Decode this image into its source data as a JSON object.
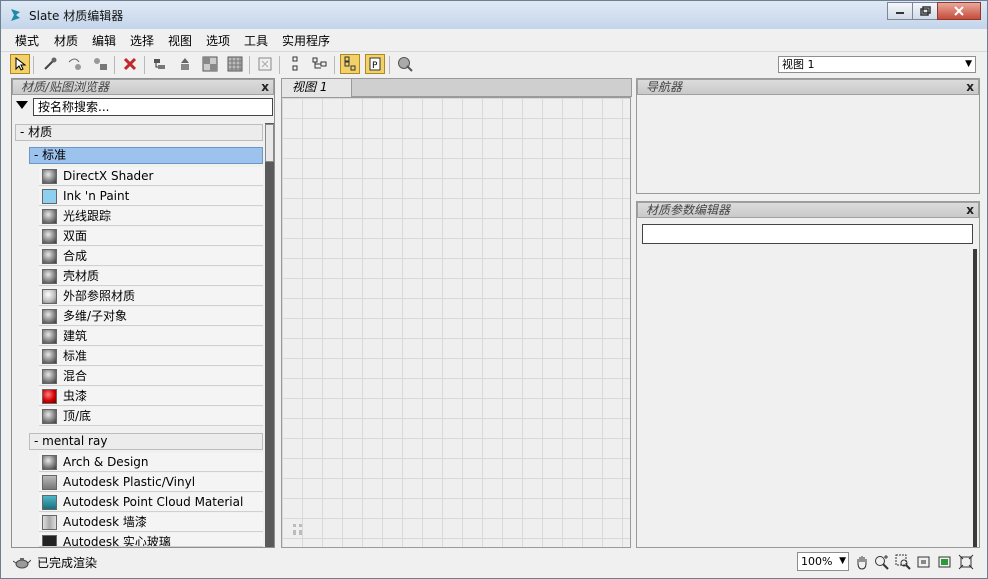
{
  "window": {
    "title": "Slate 材质编辑器"
  },
  "menu": [
    "模式",
    "材质",
    "编辑",
    "选择",
    "视图",
    "选项",
    "工具",
    "实用程序"
  ],
  "toolbar": {
    "view_select": "视图 1"
  },
  "browser": {
    "title": "材质/贴图浏览器",
    "search_placeholder": "按名称搜索...",
    "category": "- 材质",
    "subcategory": "- 标准",
    "standard_items": [
      "DirectX Shader",
      "Ink 'n Paint",
      "光线跟踪",
      "双面",
      "合成",
      "壳材质",
      "外部参照材质",
      "多维/子对象",
      "建筑",
      "标准",
      "混合",
      "虫漆",
      "顶/底"
    ],
    "mr_category": "- mental ray",
    "mr_items": [
      "Arch & Design",
      "Autodesk Plastic/Vinyl",
      "Autodesk Point Cloud Material",
      "Autodesk 墙漆",
      "Autodesk 实心玻璃"
    ]
  },
  "view": {
    "tab": "视图 1"
  },
  "navigator": {
    "title": "导航器"
  },
  "param_editor": {
    "title": "材质参数编辑器"
  },
  "status": {
    "text": "已完成渲染",
    "zoom": "100%"
  },
  "close_glyph": "x",
  "colors": {
    "accent_selected": "#9cc2ee",
    "toolbar_active": "#f3d16a",
    "shellac_swatch": "#d40000",
    "ink_swatch": "#8fd0f0"
  }
}
